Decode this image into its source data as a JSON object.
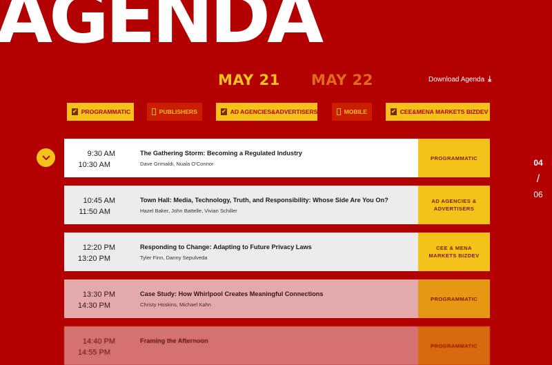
{
  "hero": {
    "title": "AGENDA"
  },
  "days": [
    {
      "label": "MAY 21",
      "active": true
    },
    {
      "label": "MAY 22",
      "active": false
    }
  ],
  "download": {
    "label": "Download Agenda",
    "icon": "download-icon"
  },
  "filters": [
    {
      "label": "PROGRAMMATIC",
      "checked": true
    },
    {
      "label": "PUBLISHERS",
      "checked": false
    },
    {
      "label": "AD AGENCIES&ADVERTISERS",
      "checked": true
    },
    {
      "label": "MOBILE",
      "checked": false
    },
    {
      "label": "CEE&MENA MARKETS BIZDEV",
      "checked": true
    }
  ],
  "sessions": [
    {
      "start": "9:30 AM",
      "end": "10:30 AM",
      "title": "The Gathering Storm: Becoming a Regulated Industry",
      "speakers": "Dave Grimaldi, Nuala O'Connor",
      "tag": "PROGRAMMATIC"
    },
    {
      "start": "10:45 AM",
      "end": "11:50 AM",
      "title": "Town Hall: Media, Technology, Truth, and Responsibility: Whose Side Are You On?",
      "speakers": "Hazel Baker, John Battelle, Vivian Schiller",
      "tag": "AD AGENCIES & ADVERTISERS"
    },
    {
      "start": "12:20 PM",
      "end": "13:20 PM",
      "title": "Responding to Change: Adapting to Future Privacy Laws",
      "speakers": "Tyler Finn, Danny Sepulveda",
      "tag": "CEE & MENA MARKETS BIZDEV"
    },
    {
      "start": "13:30 PM",
      "end": "14:30 PM",
      "title": "Case Study: How Whirlpool Creates Meaningful Connections",
      "speakers": "Christy Hoskins, Michael Kahn",
      "tag": "PROGRAMMATIC"
    },
    {
      "start": "14:40 PM",
      "end": "14:55 PM",
      "title": "Framing the Afternoon",
      "speakers": "",
      "tag": "PROGRAMMATIC"
    }
  ],
  "pager": {
    "current": "04",
    "separator": "/",
    "total": "06"
  },
  "colors": {
    "background": "#b30000",
    "accent": "#f5c21a",
    "accent_alt": "#e06a1a"
  }
}
